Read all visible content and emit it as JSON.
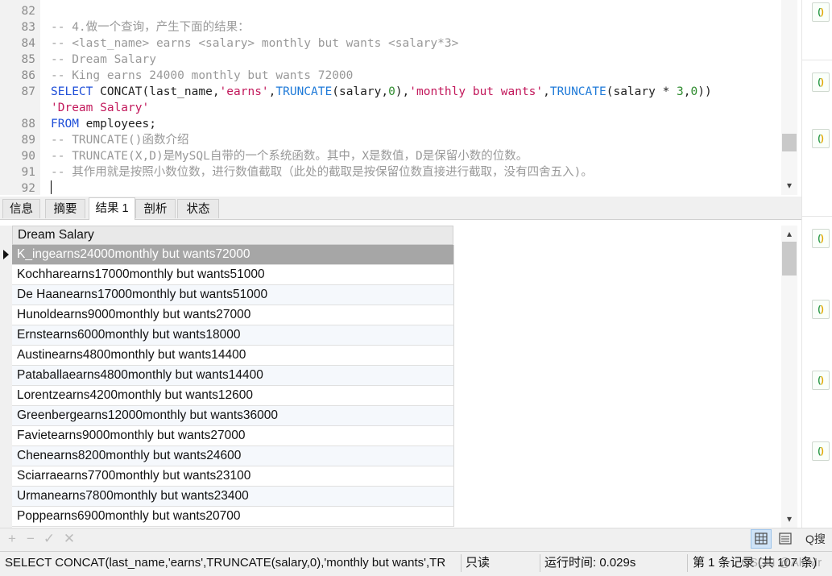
{
  "editor": {
    "lines": [
      {
        "n": "82",
        "text": ""
      },
      {
        "n": "83",
        "text": "-- 4.做一个查询，产生下面的结果："
      },
      {
        "n": "84",
        "text": "-- <last_name> earns <salary> monthly but wants <salary*3>"
      },
      {
        "n": "85",
        "text": "-- Dream Salary"
      },
      {
        "n": "86",
        "text": "-- King earns 24000 monthly but wants 72000"
      },
      {
        "n": "87",
        "kw1": "SELECT",
        "fn1": "CONCAT",
        "p1": "(last_name,",
        "s1": "'earns'",
        "p2": ",",
        "fn2": "TRUNCATE",
        "p3": "(salary,",
        "n1": "0",
        "p4": "),",
        "s2": "'monthly but wants'",
        "p5": ",",
        "fn3": "TRUNCATE",
        "p6": "(salary * ",
        "n2": "3",
        "p7": ",",
        "n3": "0",
        "p8": "))"
      },
      {
        "n": "",
        "s3": "'Dream Salary'"
      },
      {
        "n": "88",
        "kw2": "FROM",
        "p9": " employees;"
      },
      {
        "n": "89",
        "text": "-- TRUNCATE()函数介绍"
      },
      {
        "n": "90",
        "text": "-- TRUNCATE(X,D)是MySQL自带的一个系统函数。其中，X是数值，D是保留小数的位数。"
      },
      {
        "n": "91",
        "text": "-- 其作用就是按照小数位数，进行数值截取（此处的截取是按保留位数直接进行截取，没有四舍五入)。"
      },
      {
        "n": "92",
        "text": ""
      }
    ]
  },
  "tabs": [
    "信息",
    "摘要",
    "结果 1",
    "剖析",
    "状态"
  ],
  "grid": {
    "column": "Dream Salary",
    "rows": [
      "K_ingearns24000monthly but wants72000",
      "Kochharearns17000monthly but wants51000",
      "De Haanearns17000monthly but wants51000",
      "Hunoldearns9000monthly but wants27000",
      "Ernstearns6000monthly but wants18000",
      "Austinearns4800monthly but wants14400",
      "Pataballaearns4800monthly but wants14400",
      "Lorentzearns4200monthly but wants12600",
      "Greenbergearns12000monthly but wants36000",
      "Favietearns9000monthly but wants27000",
      "Chenearns8200monthly but wants24600",
      "Sciarraearns7700monthly but wants23100",
      "Urmanearns7800monthly but wants23400",
      "Poppearns6900monthly but wants20700"
    ]
  },
  "toolbar": {
    "add": "+",
    "remove": "−",
    "apply": "✓",
    "cancel": "✕",
    "search": "Q搜"
  },
  "status": {
    "query": "SELECT CONCAT(last_name,'earns',TRUNCATE(salary,0),'monthly but wants',TR",
    "readonly": "只读",
    "runtime": "运行时间: 0.029s",
    "records": "第 1 条记录 (共 107 条)",
    "watermark": "CSDN @Ali.Mr"
  },
  "colors": {
    "selected_row": "#a6a6a6",
    "keyword": "#1f4fd8",
    "string": "#c2185b",
    "number": "#2e8b2e",
    "comment": "#999999"
  }
}
